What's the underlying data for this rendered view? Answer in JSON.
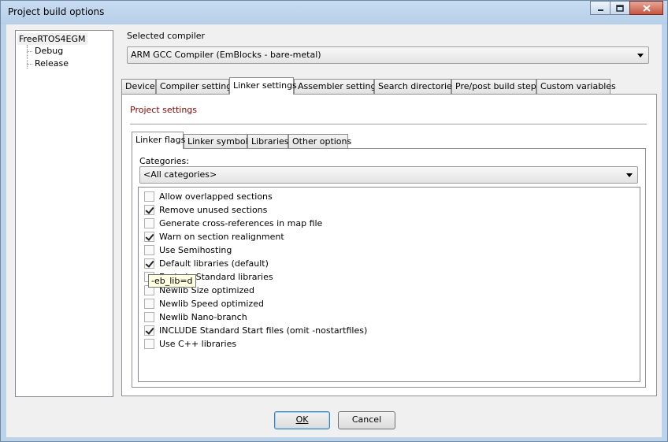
{
  "window": {
    "title": "Project build options"
  },
  "icons": {
    "minimize": "minimize-icon",
    "maximize": "maximize-icon",
    "close": "close-icon"
  },
  "tree": {
    "root": "FreeRTOS4EGM",
    "children": [
      "Debug",
      "Release"
    ]
  },
  "compiler": {
    "label": "Selected compiler",
    "value": "ARM GCC Compiler (EmBlocks - bare-metal)"
  },
  "tabs": [
    "Device",
    "Compiler settings",
    "Linker settings",
    "Assembler settings",
    "Search directories",
    "Pre/post build steps",
    "Custom variables"
  ],
  "active_tab": "Linker settings",
  "project_settings": "Project settings",
  "subtabs": [
    "Linker flags",
    "Linker symbols",
    "Libraries",
    "Other options"
  ],
  "active_subtab": "Linker flags",
  "categories": {
    "label": "Categories:",
    "value": "<All categories>"
  },
  "options": [
    {
      "label": "Allow overlapped sections",
      "checked": false
    },
    {
      "label": "Remove unused sections",
      "checked": true
    },
    {
      "label": "Generate cross-references in map file",
      "checked": false
    },
    {
      "label": "Warn on section realignment",
      "checked": true
    },
    {
      "label": "Use Semihosting",
      "checked": false
    },
    {
      "label": "Default libraries (default)",
      "checked": true
    },
    {
      "label": "Exclude Standard libraries",
      "checked": false
    },
    {
      "label": "Newlib Size optimized",
      "checked": false
    },
    {
      "label": "Newlib Speed optimized",
      "checked": false
    },
    {
      "label": "Newlib Nano-branch",
      "checked": false
    },
    {
      "label": "INCLUDE Standard Start files (omit -nostartfiles)",
      "checked": true
    },
    {
      "label": "Use C++ libraries",
      "checked": false
    }
  ],
  "tooltip": "-eb_lib=d",
  "buttons": {
    "ok": "OK",
    "cancel": "Cancel"
  }
}
